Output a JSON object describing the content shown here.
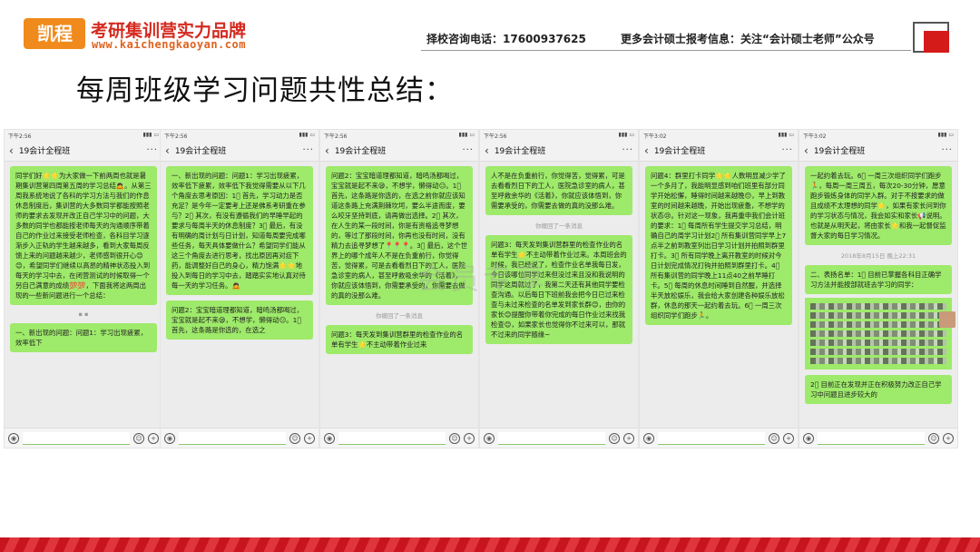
{
  "header": {
    "logo_text": "凯程",
    "brand": "考研集训营实力品牌",
    "url": "www.kaichengkaoyan.com",
    "hotline": "择校咨询电话：17600937625",
    "wechat": "更多会计硕士报考信息：关注“会计硕士老师”公众号"
  },
  "title": "每周班级学习问题共性总结：",
  "watermark": "会员专享",
  "phones": [
    {
      "time": "下午2:56",
      "group": "19会计全程班",
      "messages": [
        {
          "type": "bubble",
          "text": "同学们好🌟🌟为大家做一下前两周也就是暑期集训营第四周第五周的学习总结🙇。从第三周我系统地说了各科的学习方法与我们的作息休息制度后，集训营的大多数同学都能按照老师的要求去发现并改正自己学习中的问题，大多数的同学也都能按老师每天的沟通顺序带着自己的作业过来接受老师检查，各科目学习逐渐步入正轨的学生越来越多，看到大家每周反馈上来的问题越来越少，老师感到很开心😊😊，希望同学们继续以高昂的精神状态投入到每天的学习中去，在闭营测试的时候取得一个另自己满意的成绩💯💯，下面我将这两周出现的一些新问题进行一个总结："
        },
        {
          "type": "sys",
          "text": "▪ ▪"
        },
        {
          "type": "bubble",
          "text": "一、新出现的问题：问题1：学习出现疲累，效率低下"
        }
      ]
    },
    {
      "time": "下午2:56",
      "group": "19会计全程班",
      "messages": [
        {
          "type": "bubble",
          "text": "一、新出现的问题：问题1：学习出现疲累，效率低下疲累，效率低下我觉得需要从以下几个角度去思考原因：1⃣ 首先，学习动力是否充足？是今年一定要考上还是佛系考研重在参与？2⃣ 其次，有没有遵循我们的早睡早起的要求与每周半天的休息制度？3⃣ 最后，有没有明确的周计划与日计划，知道每周要完成哪些任务，每天具体要做什么？希望同学们能从这三个角度去进行思考，找出原因再对症下药，能调整好自己的身心，精力饱满🌟🌟地投入到每日的学习中去，踏踏实实地认真对待每一天的学习任务。🙇"
        },
        {
          "type": "bubble",
          "text": "问题2：宝宝暗道理都知道，暗鸣汤都喝过，宝宝就是起不来😪，不想学，懒得动😑。1⃣ 首先，这条路是你选的，在选之"
        }
      ]
    },
    {
      "time": "下午2:56",
      "group": "19会计全程班",
      "messages": [
        {
          "type": "bubble",
          "text": "问题2：宝宝暗道理都知道，暗鸣汤都喝过，宝宝就是起不来😪，不想学，懒得动😑。1⃣ 首先，这条路是你选的，在选之前你就应该知道这条路上充满荆棘坎坷，要么半途而废，要么咬牙坚持到底，请再做出选择。2⃣ 其次，在人生的某一段时间，你是有资格追寻梦想的，等过了那段时间，你再也没有时间，没有精力去追寻梦想了📍📍📍。3⃣ 最后，这个世界上的哪个成年人不是在负重前行，你觉得苦，觉得累，可是去看看烈日下的工人，医院急诊室的病人，甚至呼救吸余华的《活着》，你就应该体悟到，你需要承受的，你需要去做的真的没那么难。"
        },
        {
          "type": "sys",
          "text": "你撤回了一条消息"
        },
        {
          "type": "bubble",
          "text": "问题3：每天发到集训营群里的检查作业的名单有学生🌟不主动带着作业过来"
        }
      ]
    },
    {
      "time": "下午2:56",
      "group": "19会计全程班",
      "messages": [
        {
          "type": "bubble",
          "text": "人不是在负重前行，你觉得苦，觉得累，可是去看看烈日下的工人，医院急诊室的病人，甚至呼救余华的《活着》，你就应该体悟到，你需要承受的，你需要去做的真的没那么难。"
        },
        {
          "type": "sys",
          "text": "你撤回了一条消息"
        },
        {
          "type": "bubble",
          "text": "问题3：每天发到集训营群里的检查作业的名单有学生🌟不主动带着作业过来。本周班会的时候，我已经说了，检查作业名单我每日发，今日该哪位同学过来但没过来且没和我说明的同学这周就过了，我第二天还有其他同学要检查沟通。以后每日下班前我会把今日已过来检查与未过来检查的名单发到家长群😊，由你的家长😊提醒你带着你完成的每日作业过来找我检查😊，如果家长也觉得你不过来可以，那就不过来的同学随缘~"
        }
      ]
    },
    {
      "time": "下午3:02",
      "group": "19会计全程班",
      "messages": [
        {
          "type": "bubble",
          "text": "问题4：群里打卡同学🌟🌟人数明显减少学了一个多月了，我能明显感到咱们班里有部分同学开始松懈，睡得时间越来越晚😔，早上到教室的时间越来越晚，开始出现疲惫，不想学的状态😢。针对这一现象，我再重申我们会计班的要求：1⃣ 每周所有学生提交学习总结，明确自己的周学习计划2⃣ 所有集训营同学早上7点半之前到教室列出日学习计划并拍照到群里打卡。3⃣ 所有同学晚上离开教室的时候对今日计划完成情况打钩并拍照到群里打卡。4⃣ 所有集训营的同学晚上11点40之前早睡打卡。5⃣ 每周的休息时间睡到自然醒，并选择半天放松娱乐，我会给大家创建各种娱乐放松群，休息的那天一起约着去玩。6⃣ 一周三次组织同学们跑步🏃。"
        }
      ]
    },
    {
      "time": "下午3:02",
      "group": "19会计全程班",
      "messages": [
        {
          "type": "bubble",
          "text": "一起约着去玩。6⃣ 一周三次组织同学们跑步🏃，每周一周三周五，每次20-30分钟，愿意跑步锻炼身体的同学入群。对于不按要求的做且成绩不太理想的同学🌟，如果有家长问到你的学习状态与情况，我会如实和家长📢说明。也就是从明天起，将由家长🌟和我一起督促监督大家的每日学习情况。"
        },
        {
          "type": "sys",
          "text": "2018年8月15日 晚上22:31"
        },
        {
          "type": "bubble",
          "text": "二、表扬名单：1⃣ 目前已掌握各科目正确学习方法并能按部就班去学习的同学："
        },
        {
          "type": "bubble",
          "text": "2⃣ 目前正在发现并正在积极努力改正自己学习中问题且进步较大的"
        }
      ]
    }
  ]
}
